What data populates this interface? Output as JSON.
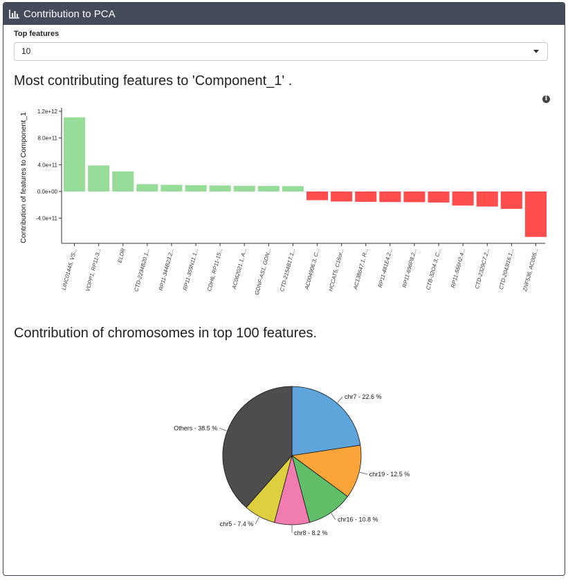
{
  "panel": {
    "title": "Contribution to PCA",
    "icon": "bar-chart-icon"
  },
  "top_features": {
    "label": "Top features",
    "value": "10"
  },
  "bar_section": {
    "title": "Most contributing features to 'Component_1' ."
  },
  "pie_section": {
    "title": "Contribution of chromosomes in top 100 features."
  },
  "colors": {
    "positive": "#98dc9a",
    "negative": "#ff4d4d",
    "header": "#444b59"
  },
  "chart_data": [
    {
      "type": "bar",
      "ylabel": "Contribution of features to Component_1",
      "ylim": [
        -680000000000.0,
        1250000000000.0
      ],
      "yticks": [
        1200000000000.0,
        800000000000.0,
        400000000000.0,
        0,
        -400000000000.0
      ],
      "ytick_labels": [
        "1.2e+12",
        "8.0e+11",
        "4.0e+11",
        "0.0e+00",
        "-4.0e+11"
      ],
      "categories": [
        "LINC01445, VS...",
        "VOPP1, RP11-3...",
        "ELDR",
        "CTD-2234B20.1...",
        "RP11-344B23.2...",
        "RP11-359N11.1...",
        "CDH6, RP11-15...",
        "AC062021.1, A...",
        "GDNF-AS1, GDN...",
        "CTD-2154B17.1...",
        "AC004906.3, C...",
        "HCCAT5, C16or...",
        "AC138647.1, R...",
        "RP11-481E4.2...",
        "RP11-696P8.2...",
        "CTB-32O4.3, C...",
        "RP11-556H2.4...",
        "CTD-2329C7.2...",
        "CTD-2043I16.1...",
        "ZNF536, AC005..."
      ],
      "values": [
        1110000000000.0,
        390000000000.0,
        300000000000.0,
        110000000000.0,
        100000000000.0,
        95000000000.0,
        90000000000.0,
        85000000000.0,
        83000000000.0,
        80000000000.0,
        -130000000000.0,
        -150000000000.0,
        -155000000000.0,
        -158000000000.0,
        -160000000000.0,
        -165000000000.0,
        -210000000000.0,
        -225000000000.0,
        -260000000000.0,
        -680000000000.0
      ]
    },
    {
      "type": "pie",
      "slices": [
        {
          "label": "chr7 - 22.6 %",
          "value": 22.6,
          "color": "#5da5da"
        },
        {
          "label": "chr19 - 12.5 %",
          "value": 12.5,
          "color": "#faa43a"
        },
        {
          "label": "chr16 - 10.8 %",
          "value": 10.8,
          "color": "#60bd68"
        },
        {
          "label": "chr8 - 8.2 %",
          "value": 8.2,
          "color": "#f17cb0"
        },
        {
          "label": "chr5 - 7.4 %",
          "value": 7.4,
          "color": "#decf3f"
        },
        {
          "label": "Others - 38.5 %",
          "value": 38.5,
          "color": "#4d4d4d"
        }
      ]
    }
  ]
}
